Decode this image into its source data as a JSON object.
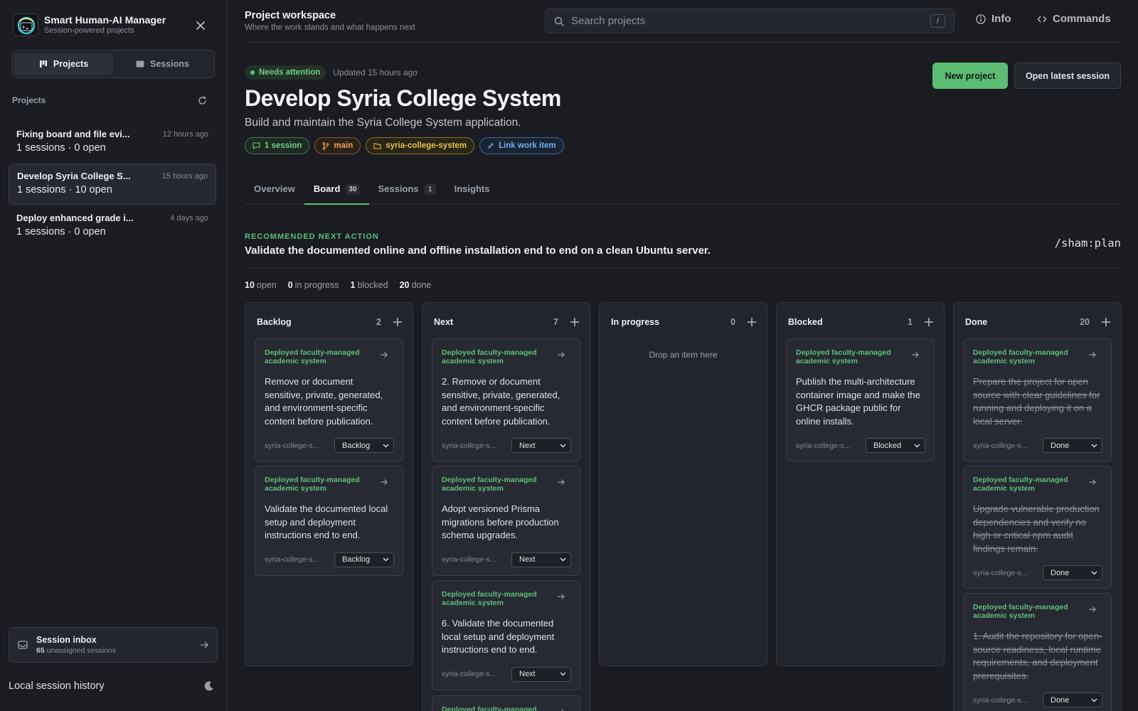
{
  "app": {
    "name": "Smart Human-AI Manager",
    "subtitle": "Session-powered projects"
  },
  "sidebar": {
    "tabs": [
      {
        "label": "Projects",
        "icon": "board-icon",
        "active": true
      },
      {
        "label": "Sessions",
        "icon": "sessions-icon",
        "active": false
      }
    ],
    "section_title": "Projects",
    "projects": [
      {
        "name": "Fixing board and file evi...",
        "time": "12 hours ago",
        "meta": "1 sessions · 0 open"
      },
      {
        "name": "Develop Syria College S...",
        "time": "15 hours ago",
        "meta": "1 sessions · 10 open"
      },
      {
        "name": "Deploy enhanced grade i...",
        "time": "4 days ago",
        "meta": "1 sessions · 0 open"
      }
    ],
    "inbox": {
      "title": "Session inbox",
      "count": "65",
      "count_suffix": "unassigned sessions"
    },
    "history_label": "Local session history"
  },
  "header": {
    "title": "Project workspace",
    "subtitle": "Where the work stands and what happens next",
    "search_placeholder": "Search projects",
    "search_shortcut": "/",
    "info_label": "Info",
    "commands_label": "Commands"
  },
  "project": {
    "status": "Needs attention",
    "updated": "Updated 15 hours ago",
    "title": "Develop Syria College System",
    "description": "Build and maintain the Syria College System application.",
    "chips": {
      "sessions": "1 session",
      "branch": "main",
      "folder": "syria-college-system",
      "link": "Link work item"
    },
    "new_project_label": "New project",
    "open_session_label": "Open latest session"
  },
  "tabs": [
    {
      "label": "Overview",
      "count": ""
    },
    {
      "label": "Board",
      "count": "30"
    },
    {
      "label": "Sessions",
      "count": "1"
    },
    {
      "label": "Insights",
      "count": ""
    }
  ],
  "recommendation": {
    "label": "RECOMMENDED NEXT ACTION",
    "text": "Validate the documented online and offline installation end to end on a clean Ubuntu server.",
    "command": "/sham:plan"
  },
  "summary": {
    "open": "10",
    "open_label": "open",
    "in_progress": "0",
    "in_progress_label": "in progress",
    "blocked": "1",
    "blocked_label": "blocked",
    "done": "20",
    "done_label": "done"
  },
  "board": {
    "drop_hint": "Drop an item here",
    "columns": [
      {
        "title": "Backlog",
        "count": "2",
        "cards": [
          {
            "tag": "Deployed faculty-managed academic system",
            "text": "Remove or document sensitive, private, generated, and environment-specific content before publication.",
            "repo": "syria-college-s...",
            "status": "Backlog"
          },
          {
            "tag": "Deployed faculty-managed academic system",
            "text": "Validate the documented local setup and deployment instructions end to end.",
            "repo": "syria-college-s...",
            "status": "Backlog"
          }
        ]
      },
      {
        "title": "Next",
        "count": "7",
        "cards": [
          {
            "tag": "Deployed faculty-managed academic system",
            "text": "2. Remove or document sensitive, private, generated, and environment-specific content before publication.",
            "repo": "syria-college-s...",
            "status": "Next"
          },
          {
            "tag": "Deployed faculty-managed academic system",
            "text": "Adopt versioned Prisma migrations before production schema upgrades.",
            "repo": "syria-college-s...",
            "status": "Next"
          },
          {
            "tag": "Deployed faculty-managed academic system",
            "text": "6. Validate the documented local setup and deployment instructions end to end.",
            "repo": "syria-college-s...",
            "status": "Next"
          },
          {
            "tag": "Deployed faculty-managed",
            "text": "",
            "repo": "",
            "status": ""
          }
        ]
      },
      {
        "title": "In progress",
        "count": "0",
        "cards": []
      },
      {
        "title": "Blocked",
        "count": "1",
        "cards": [
          {
            "tag": "Deployed faculty-managed academic system",
            "text": "Publish the multi-architecture container image and make the GHCR package public for online installs.",
            "repo": "syria-college-s...",
            "status": "Blocked"
          }
        ]
      },
      {
        "title": "Done",
        "count": "20",
        "cards": [
          {
            "tag": "Deployed faculty-managed academic system",
            "text": "Prepare the project for open source with clear guidelines for running and deploying it on a local server.",
            "repo": "syria-college-s...",
            "status": "Done"
          },
          {
            "tag": "Deployed faculty-managed academic system",
            "text": "Upgrade vulnerable production dependencies and verify no high or critical npm audit findings remain.",
            "repo": "syria-college-s...",
            "status": "Done"
          },
          {
            "tag": "Deployed faculty-managed academic system",
            "text": "1. Audit the repository for open-source readiness, local runtime requirements, and deployment prerequisites.",
            "repo": "syria-college-s...",
            "status": "Done"
          }
        ]
      }
    ]
  },
  "colors": {
    "accent": "#5cbc74",
    "background": "#1a1c22",
    "panel": "#22252c"
  }
}
